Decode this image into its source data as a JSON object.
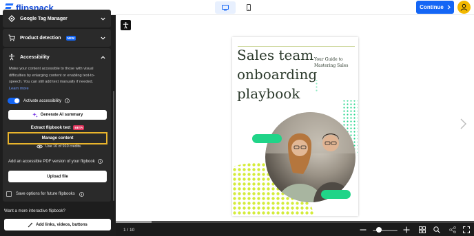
{
  "brand": {
    "name": "flipsnack",
    "color": "#1466f5"
  },
  "header": {
    "device_toggle": [
      {
        "name": "desktop",
        "icon": "monitor-icon",
        "active": true
      },
      {
        "name": "mobile",
        "icon": "phone-icon",
        "active": false
      }
    ],
    "continue_label": "Continue",
    "avatar_icon": "user-icon"
  },
  "sidebar": {
    "sections": [
      {
        "title": "Google Tag Manager",
        "icon": "diamond-icon",
        "expanded": false
      },
      {
        "title": "Product detection",
        "icon": "cart-icon",
        "badge": "NEW",
        "expanded": false
      },
      {
        "title": "Accessibility",
        "icon": "accessibility-icon",
        "expanded": true
      }
    ],
    "accessibility": {
      "description": "Make your content accessible to those with visual difficulties by enlarging content or enabling text-to-speech. You can still add text manually if needed.",
      "learn_more": "Learn more",
      "toggle_label": "Activate accessibility",
      "toggle_on": true,
      "generate_summary": "Generate AI summary",
      "extract_text": "Extract flipbook text",
      "extract_badge": "BETA",
      "manage_content": "Manage content",
      "credits": "Use 10 of 910 credits.",
      "pdf_text": "Add an accessible PDF version of your flipbook",
      "upload_file": "Upload file"
    },
    "save_options": "Save options for future flipbooks",
    "want_more": "Want a more interactive flipbook?",
    "add_links": "Add links, videos, buttons"
  },
  "document": {
    "title_lines": [
      "Sales team",
      "onboarding",
      "playbook"
    ],
    "subtitle": "Your Guide to Mastering Sales",
    "accent_color": "#20d488",
    "dots_color": "#d4ec3a"
  },
  "footer": {
    "page_indicator": "1 / 10",
    "progress": 0.1,
    "zoom_level": 0.25
  }
}
